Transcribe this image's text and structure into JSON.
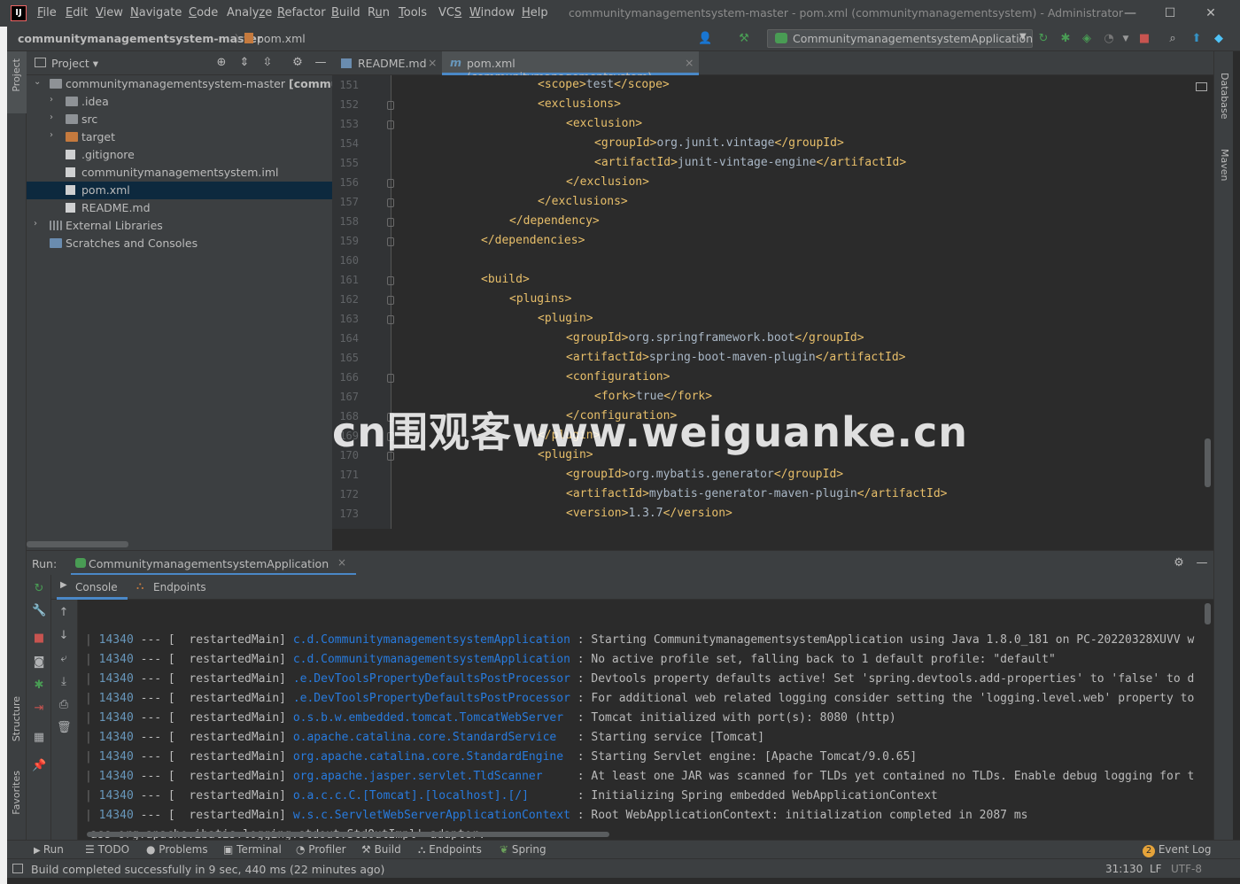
{
  "titlebar": {
    "logo": "IJ",
    "menu": [
      {
        "pre": "",
        "u": "F",
        "post": "ile"
      },
      {
        "pre": "",
        "u": "E",
        "post": "dit"
      },
      {
        "pre": "",
        "u": "V",
        "post": "iew"
      },
      {
        "pre": "",
        "u": "N",
        "post": "avigate"
      },
      {
        "pre": "",
        "u": "C",
        "post": "ode"
      },
      {
        "pre": "Analy",
        "u": "z",
        "post": "e"
      },
      {
        "pre": "",
        "u": "R",
        "post": "efactor"
      },
      {
        "pre": "",
        "u": "B",
        "post": "uild"
      },
      {
        "pre": "R",
        "u": "u",
        "post": "n"
      },
      {
        "pre": "",
        "u": "T",
        "post": "ools"
      },
      {
        "pre": "VC",
        "u": "S",
        "post": ""
      },
      {
        "pre": "",
        "u": "W",
        "post": "indow"
      },
      {
        "pre": "",
        "u": "H",
        "post": "elp"
      }
    ],
    "window_title": "communitymanagementsystem-master - pom.xml (communitymanagementsystem) - Administrator"
  },
  "navbar": {
    "project": "communitymanagementsystem-master",
    "separator": "〉",
    "file": "pom.xml",
    "run_config": "CommunitymanagementsystemApplication"
  },
  "left_strip": {
    "project": "Project",
    "structure": "Structure",
    "favorites": "Favorites"
  },
  "right_strip": {
    "database": "Database",
    "maven": "Maven"
  },
  "project_panel": {
    "title": "Project",
    "tree": [
      {
        "label": "communitymanagementsystem-master [community",
        "indent": 0,
        "arrow": "⌄",
        "icon": "folder"
      },
      {
        "label": ".idea",
        "indent": 1,
        "arrow": "›",
        "icon": "folder"
      },
      {
        "label": "src",
        "indent": 1,
        "arrow": "›",
        "icon": "folder"
      },
      {
        "label": "target",
        "indent": 1,
        "arrow": "›",
        "icon": "folder-orange"
      },
      {
        "label": ".gitignore",
        "indent": 1,
        "arrow": "",
        "icon": "file"
      },
      {
        "label": "communitymanagementsystem.iml",
        "indent": 1,
        "arrow": "",
        "icon": "file"
      },
      {
        "label": "pom.xml",
        "indent": 1,
        "arrow": "",
        "icon": "file",
        "selected": true
      },
      {
        "label": "README.md",
        "indent": 1,
        "arrow": "",
        "icon": "file"
      },
      {
        "label": "External Libraries",
        "indent": 0,
        "arrow": "›",
        "icon": "lib"
      },
      {
        "label": "Scratches and Consoles",
        "indent": 0,
        "arrow": "",
        "icon": "scratch"
      }
    ]
  },
  "editor": {
    "tabs": [
      {
        "label": "README.md",
        "close": "×",
        "active": false
      },
      {
        "label": "pom.xml (communitymanagementsystem)",
        "close": "×",
        "active": true
      }
    ],
    "lines": [
      {
        "n": "151",
        "indent": 5,
        "open": "<scope>",
        "text": "test",
        "close": "</scope>"
      },
      {
        "n": "152",
        "indent": 5,
        "open": "<exclusions>",
        "text": "",
        "close": ""
      },
      {
        "n": "153",
        "indent": 6,
        "open": "<exclusion>",
        "text": "",
        "close": ""
      },
      {
        "n": "154",
        "indent": 7,
        "open": "<groupId>",
        "text": "org.junit.vintage",
        "close": "</groupId>"
      },
      {
        "n": "155",
        "indent": 7,
        "open": "<artifactId>",
        "text": "junit-vintage-engine",
        "close": "</artifactId>"
      },
      {
        "n": "156",
        "indent": 6,
        "open": "</exclusion>",
        "text": "",
        "close": ""
      },
      {
        "n": "157",
        "indent": 5,
        "open": "</exclusions>",
        "text": "",
        "close": ""
      },
      {
        "n": "158",
        "indent": 4,
        "open": "</dependency>",
        "text": "",
        "close": ""
      },
      {
        "n": "159",
        "indent": 3,
        "open": "</dependencies>",
        "text": "",
        "close": ""
      },
      {
        "n": "160",
        "indent": 0,
        "open": "",
        "text": "",
        "close": ""
      },
      {
        "n": "161",
        "indent": 3,
        "open": "<build>",
        "text": "",
        "close": ""
      },
      {
        "n": "162",
        "indent": 4,
        "open": "<plugins>",
        "text": "",
        "close": ""
      },
      {
        "n": "163",
        "indent": 5,
        "open": "<plugin>",
        "text": "",
        "close": ""
      },
      {
        "n": "164",
        "indent": 6,
        "open": "<groupId>",
        "text": "org.springframework.boot",
        "close": "</groupId>"
      },
      {
        "n": "165",
        "indent": 6,
        "open": "<artifactId>",
        "text": "spring-boot-maven-plugin",
        "close": "</artifactId>"
      },
      {
        "n": "166",
        "indent": 6,
        "open": "<configuration>",
        "text": "",
        "close": ""
      },
      {
        "n": "167",
        "indent": 7,
        "open": "<fork>",
        "text": "true",
        "close": "</fork>"
      },
      {
        "n": "168",
        "indent": 6,
        "open": "</configuration>",
        "text": "",
        "close": ""
      },
      {
        "n": "169",
        "indent": 5,
        "open": "</plugin>",
        "text": "",
        "close": ""
      },
      {
        "n": "170",
        "indent": 5,
        "open": "<plugin>",
        "text": "",
        "close": ""
      },
      {
        "n": "171",
        "indent": 6,
        "open": "<groupId>",
        "text": "org.mybatis.generator",
        "close": "</groupId>"
      },
      {
        "n": "172",
        "indent": 6,
        "open": "<artifactId>",
        "text": "mybatis-generator-maven-plugin",
        "close": "</artifactId>"
      },
      {
        "n": "173",
        "indent": 6,
        "open": "<version>",
        "text": "1.3.7",
        "close": "</version>"
      }
    ]
  },
  "watermark": "cn围观客www.weiguanke.cn",
  "run": {
    "label": "Run:",
    "tab": "CommunitymanagementsystemApplication",
    "tab_close": "×",
    "subtabs": [
      "Console",
      "Endpoints"
    ],
    "logs": [
      {
        "pid": "14340",
        "sep": "--- [",
        "thread": "  restartedMain]",
        "cls": "c.d.CommunitymanagementsystemApplication",
        "msg": " : Starting CommunitymanagementsystemApplication using Java 1.8.0_181 on PC-20220328XUVV w"
      },
      {
        "pid": "14340",
        "sep": "--- [",
        "thread": "  restartedMain]",
        "cls": "c.d.CommunitymanagementsystemApplication",
        "msg": " : No active profile set, falling back to 1 default profile: \"default\""
      },
      {
        "pid": "14340",
        "sep": "--- [",
        "thread": "  restartedMain]",
        "cls": ".e.DevToolsPropertyDefaultsPostProcessor",
        "msg": " : Devtools property defaults active! Set 'spring.devtools.add-properties' to 'false' to d"
      },
      {
        "pid": "14340",
        "sep": "--- [",
        "thread": "  restartedMain]",
        "cls": ".e.DevToolsPropertyDefaultsPostProcessor",
        "msg": " : For additional web related logging consider setting the 'logging.level.web' property to"
      },
      {
        "pid": "14340",
        "sep": "--- [",
        "thread": "  restartedMain]",
        "cls": "o.s.b.w.embedded.tomcat.TomcatWebServer ",
        "msg": " : Tomcat initialized with port(s): 8080 (http)"
      },
      {
        "pid": "14340",
        "sep": "--- [",
        "thread": "  restartedMain]",
        "cls": "o.apache.catalina.core.StandardService  ",
        "msg": " : Starting service [Tomcat]"
      },
      {
        "pid": "14340",
        "sep": "--- [",
        "thread": "  restartedMain]",
        "cls": "org.apache.catalina.core.StandardEngine ",
        "msg": " : Starting Servlet engine: [Apache Tomcat/9.0.65]"
      },
      {
        "pid": "14340",
        "sep": "--- [",
        "thread": "  restartedMain]",
        "cls": "org.apache.jasper.servlet.TldScanner    ",
        "msg": " : At least one JAR was scanned for TLDs yet contained no TLDs. Enable debug logging for t"
      },
      {
        "pid": "14340",
        "sep": "--- [",
        "thread": "  restartedMain]",
        "cls": "o.a.c.c.C.[Tomcat].[localhost].[/]      ",
        "msg": " : Initializing Spring embedded WebApplicationContext"
      },
      {
        "pid": "14340",
        "sep": "--- [",
        "thread": "  restartedMain]",
        "cls": "w.s.c.ServletWebServerApplicationContext",
        "msg": " : Root WebApplicationContext: initialization completed in 2087 ms"
      }
    ],
    "partial_line": "ass org.apache.ibatis.logging.stdout.StdOutImpl' adapter."
  },
  "bottom_tabs": [
    "Run",
    "TODO",
    "Problems",
    "Terminal",
    "Profiler",
    "Build",
    "Endpoints",
    "Spring"
  ],
  "event_log": {
    "count": "2",
    "label": "Event Log"
  },
  "status": {
    "message": "Build completed successfully in 9 sec, 440 ms (22 minutes ago)",
    "position": "31:130",
    "line_sep": "LF",
    "encoding": "UTF-8"
  },
  "colors": {
    "accent": "#4a88c7",
    "tag": "#e8bf6a",
    "log_class": "#287bde",
    "log_pid": "#6897bb",
    "selection": "#0d293e"
  }
}
